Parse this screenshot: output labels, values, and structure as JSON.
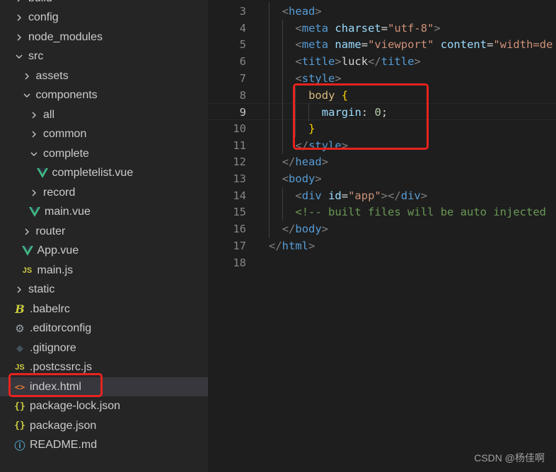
{
  "explorer": {
    "items": [
      {
        "label": "build",
        "type": "folder",
        "expanded": false,
        "depth": 0
      },
      {
        "label": "config",
        "type": "folder",
        "expanded": false,
        "depth": 0
      },
      {
        "label": "node_modules",
        "type": "folder",
        "expanded": false,
        "depth": 0
      },
      {
        "label": "src",
        "type": "folder",
        "expanded": true,
        "depth": 0
      },
      {
        "label": "assets",
        "type": "folder",
        "expanded": false,
        "depth": 1
      },
      {
        "label": "components",
        "type": "folder",
        "expanded": true,
        "depth": 1
      },
      {
        "label": "all",
        "type": "folder",
        "expanded": false,
        "depth": 2
      },
      {
        "label": "common",
        "type": "folder",
        "expanded": false,
        "depth": 2
      },
      {
        "label": "complete",
        "type": "folder",
        "expanded": true,
        "depth": 2
      },
      {
        "label": "completelist.vue",
        "type": "vue",
        "depth": 3
      },
      {
        "label": "record",
        "type": "folder",
        "expanded": false,
        "depth": 2
      },
      {
        "label": "main.vue",
        "type": "vue",
        "depth": 2
      },
      {
        "label": "router",
        "type": "folder",
        "expanded": false,
        "depth": 1
      },
      {
        "label": "App.vue",
        "type": "vue",
        "depth": 1
      },
      {
        "label": "main.js",
        "type": "js",
        "depth": 1
      },
      {
        "label": "static",
        "type": "folder",
        "expanded": false,
        "depth": 0
      },
      {
        "label": ".babelrc",
        "type": "babel",
        "depth": 0
      },
      {
        "label": ".editorconfig",
        "type": "gear",
        "depth": 0
      },
      {
        "label": ".gitignore",
        "type": "git",
        "depth": 0
      },
      {
        "label": ".postcssrc.js",
        "type": "js",
        "depth": 0
      },
      {
        "label": "index.html",
        "type": "html",
        "depth": 0,
        "selected": true
      },
      {
        "label": "package-lock.json",
        "type": "json",
        "depth": 0
      },
      {
        "label": "package.json",
        "type": "json",
        "depth": 0
      },
      {
        "label": "README.md",
        "type": "info",
        "depth": 0
      }
    ]
  },
  "editor": {
    "current_line": 9,
    "lines": [
      {
        "num": 3,
        "indent": 1,
        "tokens": [
          [
            "punc",
            "<"
          ],
          [
            "tag",
            "head"
          ],
          [
            "punc",
            ">"
          ]
        ]
      },
      {
        "num": 4,
        "indent": 2,
        "tokens": [
          [
            "punc",
            "<"
          ],
          [
            "tag",
            "meta"
          ],
          [
            "text",
            " "
          ],
          [
            "attr",
            "charset"
          ],
          [
            "text",
            "="
          ],
          [
            "str",
            "\"utf-8\""
          ],
          [
            "punc",
            ">"
          ]
        ]
      },
      {
        "num": 5,
        "indent": 2,
        "tokens": [
          [
            "punc",
            "<"
          ],
          [
            "tag",
            "meta"
          ],
          [
            "text",
            " "
          ],
          [
            "attr",
            "name"
          ],
          [
            "text",
            "="
          ],
          [
            "str",
            "\"viewport\""
          ],
          [
            "text",
            " "
          ],
          [
            "attr",
            "content"
          ],
          [
            "text",
            "="
          ],
          [
            "str",
            "\"width=de"
          ]
        ]
      },
      {
        "num": 6,
        "indent": 2,
        "tokens": [
          [
            "punc",
            "<"
          ],
          [
            "tag",
            "title"
          ],
          [
            "punc",
            ">"
          ],
          [
            "text",
            "luck"
          ],
          [
            "punc",
            "</"
          ],
          [
            "tag",
            "title"
          ],
          [
            "punc",
            ">"
          ]
        ]
      },
      {
        "num": 7,
        "indent": 2,
        "tokens": [
          [
            "punc",
            "<"
          ],
          [
            "tag",
            "style"
          ],
          [
            "punc",
            ">"
          ]
        ]
      },
      {
        "num": 8,
        "indent": 3,
        "tokens": [
          [
            "sel",
            "body"
          ],
          [
            "text",
            " "
          ],
          [
            "brace",
            "{"
          ]
        ]
      },
      {
        "num": 9,
        "indent": 4,
        "tokens": [
          [
            "prop",
            "margin"
          ],
          [
            "text",
            ": "
          ],
          [
            "num",
            "0"
          ],
          [
            "text",
            ";"
          ]
        ]
      },
      {
        "num": 10,
        "indent": 3,
        "tokens": [
          [
            "brace",
            "}"
          ]
        ]
      },
      {
        "num": 11,
        "indent": 2,
        "tokens": [
          [
            "punc",
            "</"
          ],
          [
            "tag",
            "style"
          ],
          [
            "punc",
            ">"
          ]
        ]
      },
      {
        "num": 12,
        "indent": 1,
        "tokens": [
          [
            "punc",
            "</"
          ],
          [
            "tag",
            "head"
          ],
          [
            "punc",
            ">"
          ]
        ]
      },
      {
        "num": 13,
        "indent": 1,
        "tokens": [
          [
            "punc",
            "<"
          ],
          [
            "tag",
            "body"
          ],
          [
            "punc",
            ">"
          ]
        ]
      },
      {
        "num": 14,
        "indent": 2,
        "tokens": [
          [
            "punc",
            "<"
          ],
          [
            "tag",
            "div"
          ],
          [
            "text",
            " "
          ],
          [
            "attr",
            "id"
          ],
          [
            "text",
            "="
          ],
          [
            "str",
            "\"app\""
          ],
          [
            "punc",
            "></"
          ],
          [
            "tag",
            "div"
          ],
          [
            "punc",
            ">"
          ]
        ]
      },
      {
        "num": 15,
        "indent": 2,
        "tokens": [
          [
            "comment",
            "<!-- built files will be auto injected"
          ]
        ]
      },
      {
        "num": 16,
        "indent": 1,
        "tokens": [
          [
            "punc",
            "</"
          ],
          [
            "tag",
            "body"
          ],
          [
            "punc",
            ">"
          ]
        ]
      },
      {
        "num": 17,
        "indent": 0,
        "tokens": [
          [
            "punc",
            "</"
          ],
          [
            "tag",
            "html"
          ],
          [
            "punc",
            ">"
          ]
        ]
      },
      {
        "num": 18,
        "indent": 0,
        "tokens": []
      }
    ]
  },
  "watermark": "CSDN @杨佳啊",
  "colors": {
    "sidebar_bg": "#252526",
    "editor_bg": "#1e1e1e",
    "selected_bg": "#37373d",
    "highlight_box": "#e8231e",
    "vue_icon": "#41b883"
  }
}
